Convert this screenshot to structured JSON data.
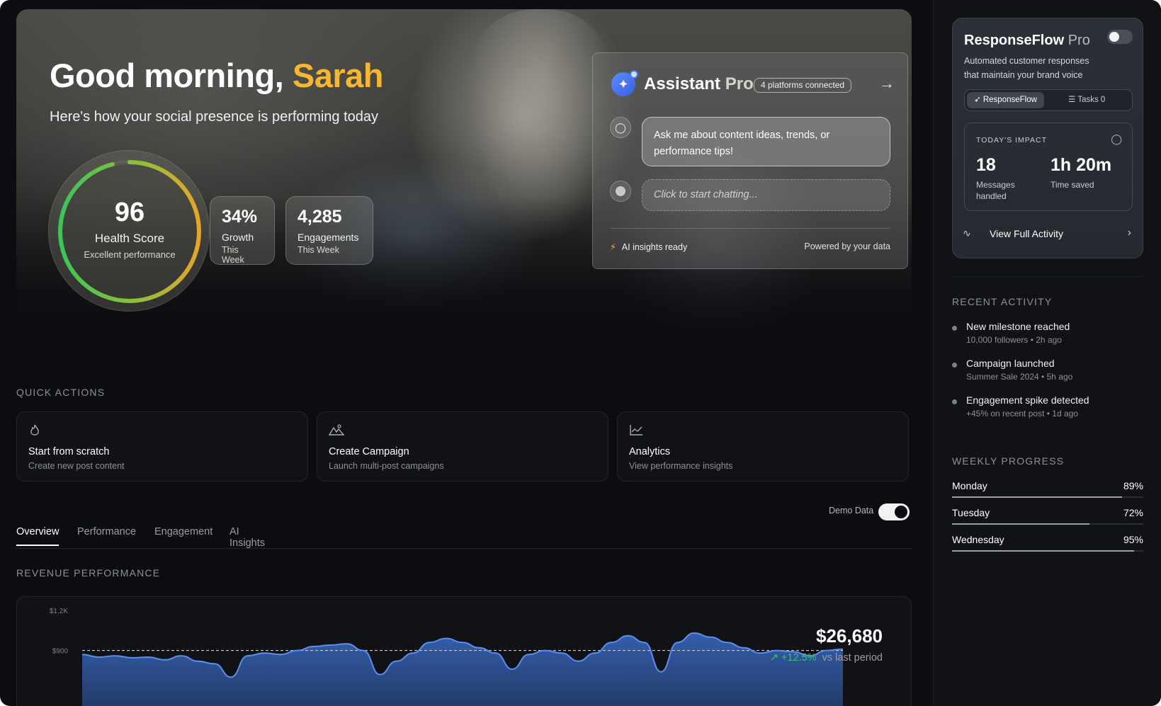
{
  "hero": {
    "greeting_prefix": "Good morning,",
    "user_name": "Sarah",
    "subtitle": "Here's how your social presence is performing today",
    "health_score": {
      "value": "96",
      "label": "Health Score",
      "sub": "Excellent performance",
      "fraction": 0.96
    },
    "stats": [
      {
        "value": "34%",
        "label": "Growth",
        "sub": "This Week"
      },
      {
        "value": "4,285",
        "label": "Engagements",
        "sub": "This Week"
      }
    ]
  },
  "assistant": {
    "title": "Assistant",
    "title_suffix": "Pro",
    "badge": "4 platforms connected",
    "bubble": "Ask me about content ideas, trends, or performance tips!",
    "input_placeholder": "Click to start chatting...",
    "status": "AI insights ready",
    "powered_by": "Powered by your data"
  },
  "quick_actions": {
    "title": "QUICK ACTIONS",
    "items": [
      {
        "icon": "flame-icon",
        "title": "Start from scratch",
        "sub": "Create new post content"
      },
      {
        "icon": "mountain-icon",
        "title": "Create Campaign",
        "sub": "Launch multi-post campaigns"
      },
      {
        "icon": "chart-line-icon",
        "title": "Analytics",
        "sub": "View performance insights"
      }
    ]
  },
  "demo_toggle": {
    "label": "Demo Data",
    "on": true
  },
  "tabs": [
    {
      "label": "Overview",
      "active": true
    },
    {
      "label": "Performance",
      "active": false
    },
    {
      "label": "Engagement",
      "active": false
    },
    {
      "label": "AI Insights",
      "active": false
    }
  ],
  "revenue": {
    "title": "REVENUE PERFORMANCE",
    "total": "$26,680",
    "change": "+12.5%",
    "change_suffix": "vs last period"
  },
  "chart_data": {
    "type": "area",
    "title": "",
    "xlabel": "",
    "ylabel": "",
    "y_ticks": [
      "$1.2K",
      "$900"
    ],
    "ylim": [
      400,
      1300
    ],
    "grid": false,
    "reference_line": 900,
    "series": [
      {
        "values": [
          870,
          850,
          860,
          845,
          850,
          830,
          860,
          820,
          800,
          700,
          860,
          880,
          870,
          900,
          930,
          940,
          950,
          900,
          720,
          820,
          880,
          960,
          990,
          960,
          920,
          880,
          760,
          870,
          900,
          880,
          820,
          880,
          960,
          1010,
          960,
          740,
          960,
          1030,
          1000,
          960,
          920,
          880,
          900,
          890,
          860,
          900,
          910
        ]
      }
    ]
  },
  "sidebar": {
    "responseflow": {
      "title": "ResponseFlow",
      "title_suffix": "Pro",
      "toggle_on": false,
      "description": "Automated customer responses that maintain your brand voice",
      "tab_active": "ResponseFlow",
      "tab_other": "Tasks 0",
      "impact_label": "TODAY'S IMPACT",
      "messages_value": "18",
      "messages_label": "Messages handled",
      "time_value": "1h 20m",
      "time_label": "Time saved",
      "link": "View Full Activity"
    },
    "recent_activity": {
      "title": "RECENT ACTIVITY",
      "items": [
        {
          "title": "New milestone reached",
          "meta": "10,000 followers • 2h ago"
        },
        {
          "title": "Campaign launched",
          "meta": "Summer Sale 2024 • 5h ago"
        },
        {
          "title": "Engagement spike detected",
          "meta": "+45% on recent post • 1d ago"
        }
      ]
    },
    "weekly_progress": {
      "title": "WEEKLY PROGRESS",
      "items": [
        {
          "day": "Monday",
          "pct": "89%",
          "value": 0.89
        },
        {
          "day": "Tuesday",
          "pct": "72%",
          "value": 0.72
        },
        {
          "day": "Wednesday",
          "pct": "95%",
          "value": 0.95
        }
      ]
    }
  },
  "colors": {
    "accent_yellow": "#f5b731",
    "positive_green": "#35c76b",
    "chart_blue": "#3f78e0",
    "ring_green": "#3cc35a",
    "ring_orange": "#e6a52a"
  }
}
